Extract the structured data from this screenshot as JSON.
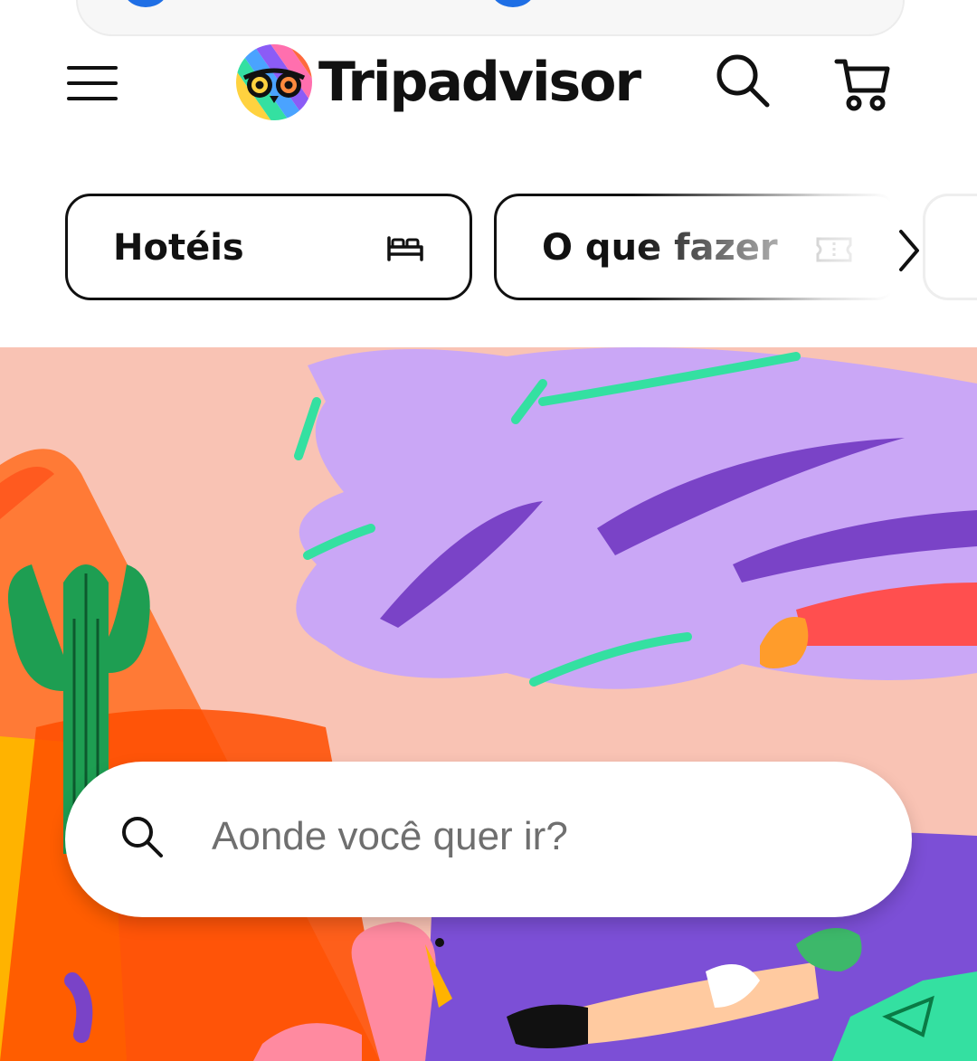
{
  "header": {
    "logo_text": "Tripadvisor",
    "menu_icon": "hamburger-menu-icon",
    "search_icon": "search-icon",
    "cart_icon": "cart-icon"
  },
  "tabs": [
    {
      "label": "Hotéis",
      "icon": "bed-icon"
    },
    {
      "label": "O que fazer",
      "icon": "ticket-icon"
    }
  ],
  "tabs_next_icon": "chevron-right-icon",
  "search": {
    "placeholder": "Aonde você quer ir?",
    "icon": "search-icon"
  },
  "colors": {
    "text": "#111111",
    "hero_bg": "#f9c3b4",
    "accent_green": "#34e0a1",
    "lavender": "#c8a6f2",
    "purple": "#7a4bc9"
  }
}
